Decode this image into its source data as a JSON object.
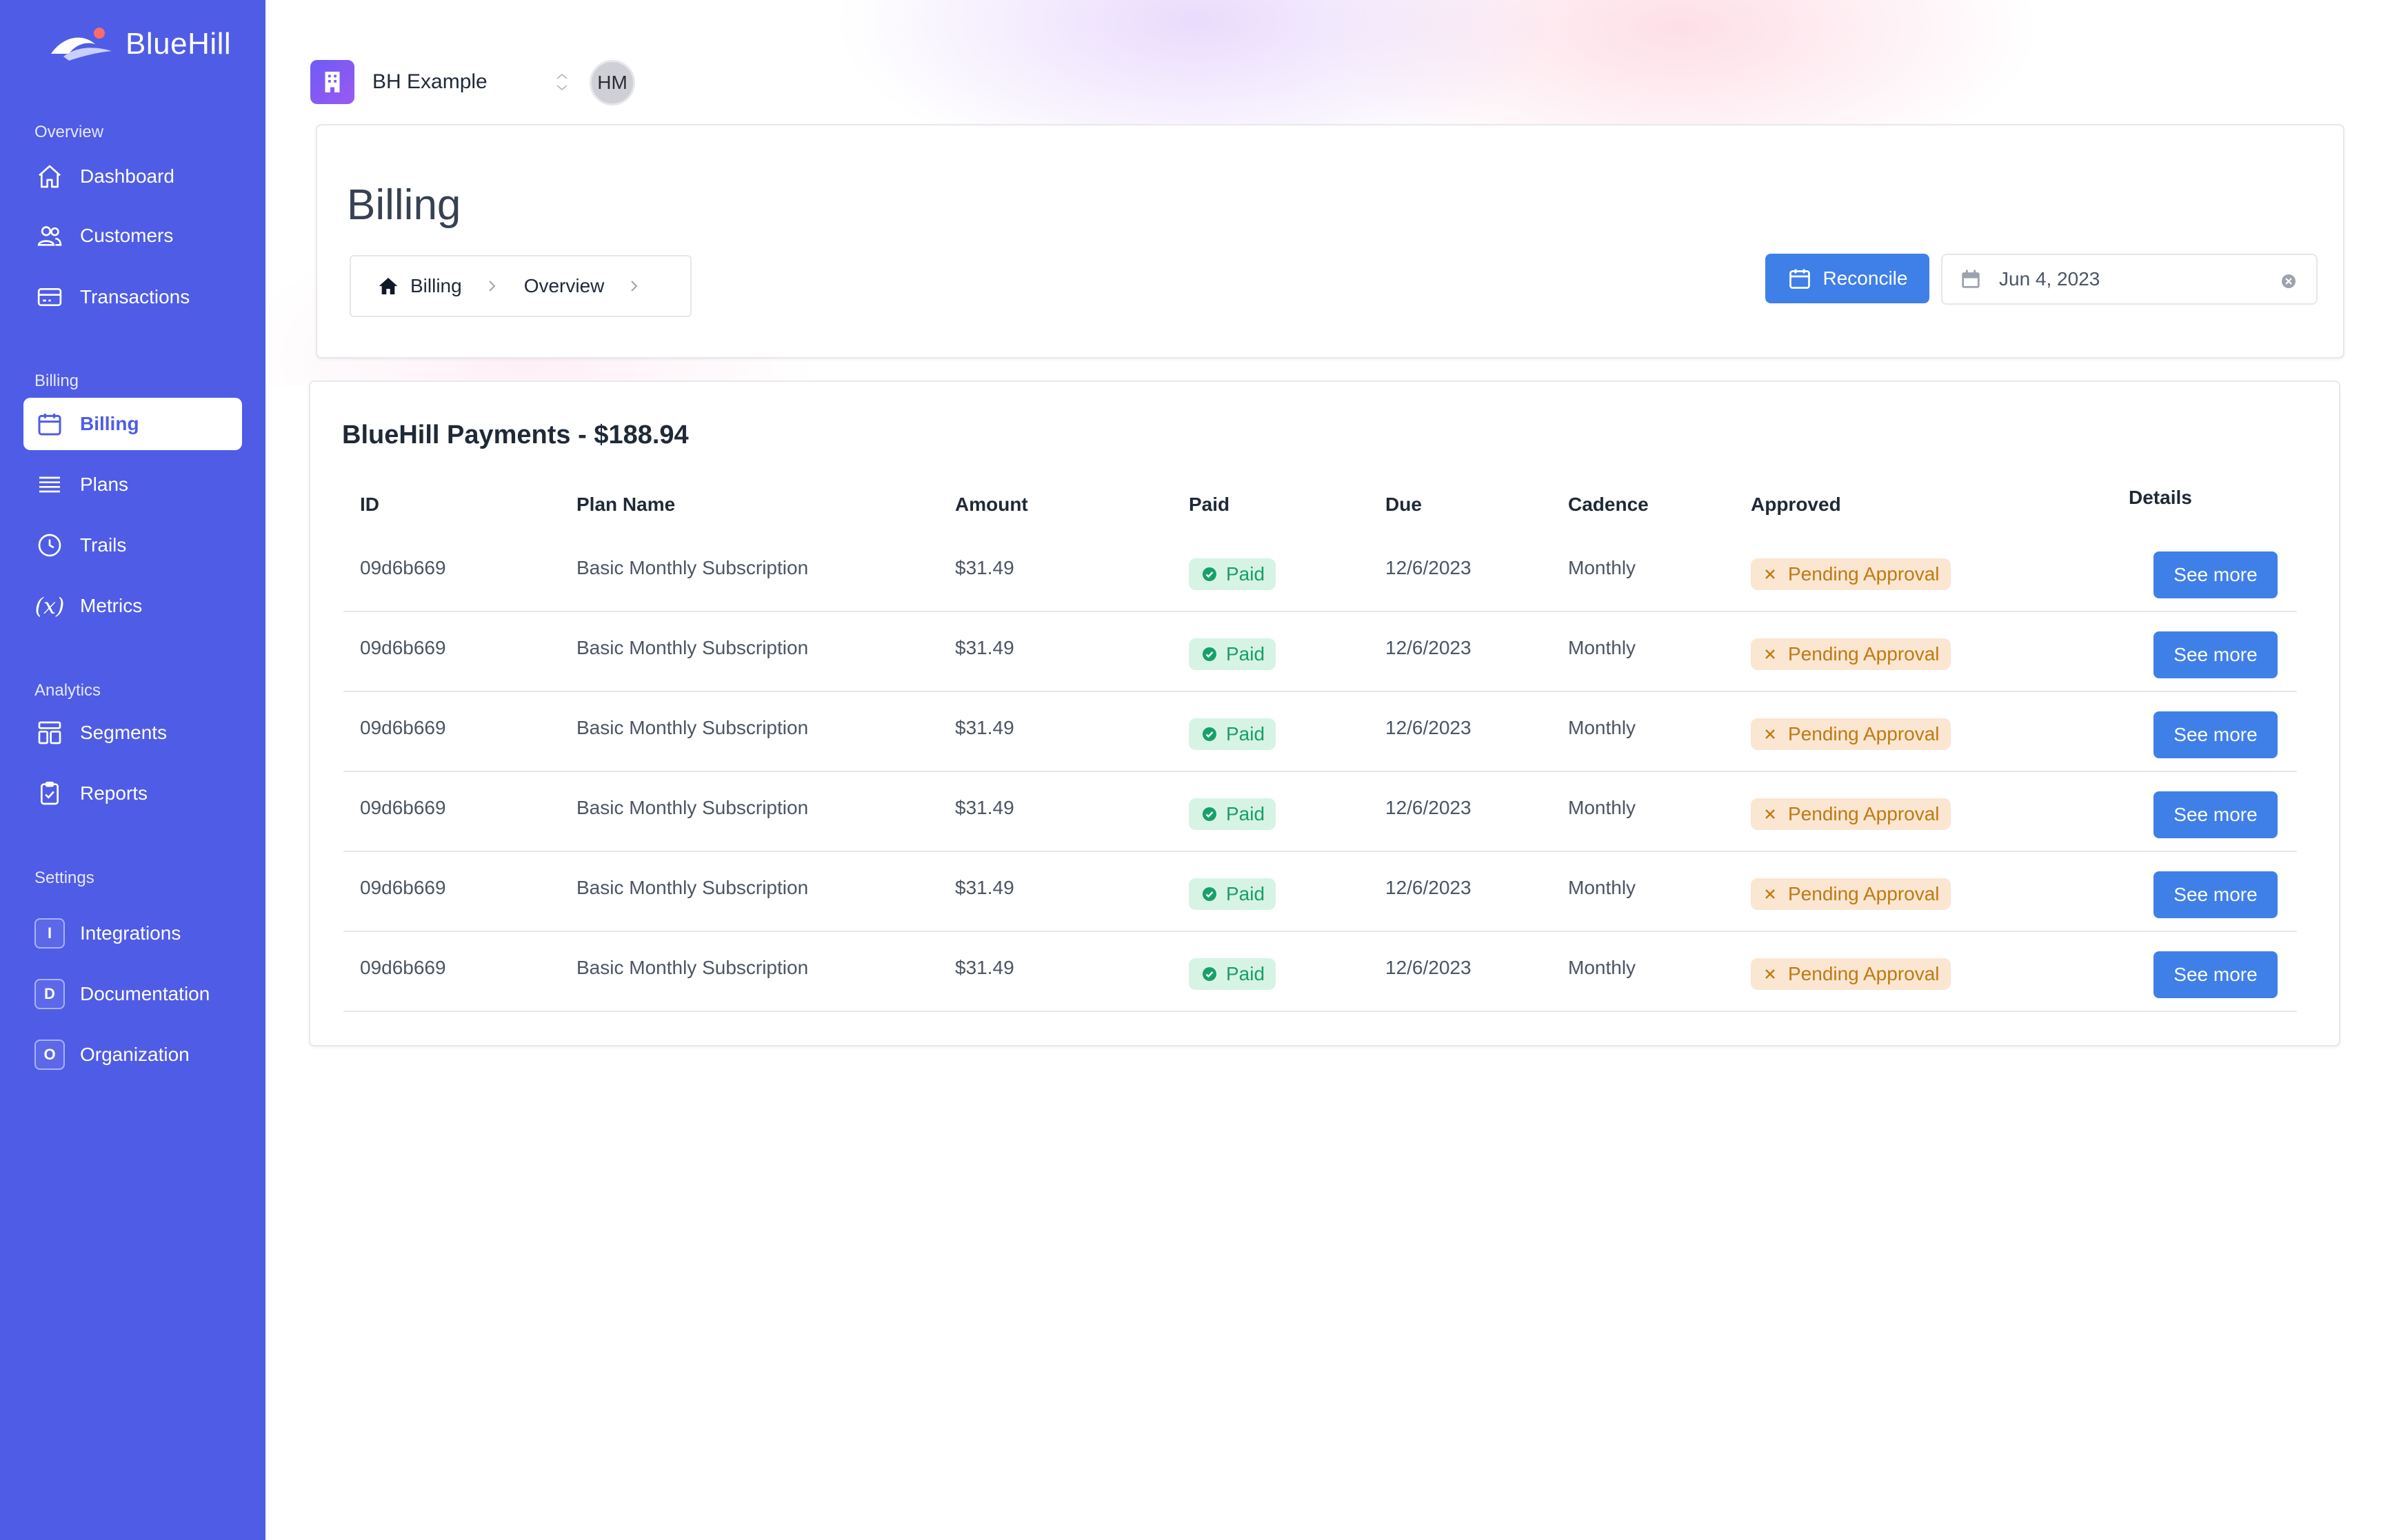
{
  "brand": {
    "name": "BlueHill"
  },
  "sidebar": {
    "sections": [
      {
        "label": "Overview"
      },
      {
        "label": "Billing"
      },
      {
        "label": "Analytics"
      },
      {
        "label": "Settings"
      }
    ],
    "items": [
      {
        "label": "Dashboard",
        "icon": "home-icon"
      },
      {
        "label": "Customers",
        "icon": "users-icon"
      },
      {
        "label": "Transactions",
        "icon": "credit-card-icon"
      },
      {
        "label": "Billing",
        "icon": "calendar-icon",
        "active": true
      },
      {
        "label": "Plans",
        "icon": "list-icon"
      },
      {
        "label": "Trails",
        "icon": "clock-icon"
      },
      {
        "label": "Metrics",
        "icon": "variable-icon",
        "glyph": "(x)"
      },
      {
        "label": "Segments",
        "icon": "segments-icon"
      },
      {
        "label": "Reports",
        "icon": "clipboard-check-icon"
      },
      {
        "label": "Integrations",
        "badge": "I"
      },
      {
        "label": "Documentation",
        "badge": "D"
      },
      {
        "label": "Organization",
        "badge": "O"
      }
    ]
  },
  "workspace": {
    "name": "BH Example",
    "avatar_initials": "HM"
  },
  "header": {
    "title": "Billing",
    "breadcrumb": [
      "Billing",
      "Overview"
    ],
    "reconcile_label": "Reconcile",
    "date_value": "Jun 4, 2023"
  },
  "payments": {
    "title": "BlueHill Payments - $188.94",
    "columns": [
      "ID",
      "Plan Name",
      "Amount",
      "Paid",
      "Due",
      "Cadence",
      "Approved",
      "Details"
    ],
    "rows": [
      {
        "id": "09d6b669",
        "plan": "Basic Monthly Subscription",
        "amount": "$31.49",
        "paid": "Paid",
        "due": "12/6/2023",
        "cadence": "Monthly",
        "approved": "Pending Approval",
        "action": "See more"
      },
      {
        "id": "09d6b669",
        "plan": "Basic Monthly Subscription",
        "amount": "$31.49",
        "paid": "Paid",
        "due": "12/6/2023",
        "cadence": "Monthly",
        "approved": "Pending Approval",
        "action": "See more"
      },
      {
        "id": "09d6b669",
        "plan": "Basic Monthly Subscription",
        "amount": "$31.49",
        "paid": "Paid",
        "due": "12/6/2023",
        "cadence": "Monthly",
        "approved": "Pending Approval",
        "action": "See more"
      },
      {
        "id": "09d6b669",
        "plan": "Basic Monthly Subscription",
        "amount": "$31.49",
        "paid": "Paid",
        "due": "12/6/2023",
        "cadence": "Monthly",
        "approved": "Pending Approval",
        "action": "See more"
      },
      {
        "id": "09d6b669",
        "plan": "Basic Monthly Subscription",
        "amount": "$31.49",
        "paid": "Paid",
        "due": "12/6/2023",
        "cadence": "Monthly",
        "approved": "Pending Approval",
        "action": "See more"
      },
      {
        "id": "09d6b669",
        "plan": "Basic Monthly Subscription",
        "amount": "$31.49",
        "paid": "Paid",
        "due": "12/6/2023",
        "cadence": "Monthly",
        "approved": "Pending Approval",
        "action": "See more"
      }
    ]
  },
  "colors": {
    "sidebar_bg": "#4f5ce6",
    "accent": "#3f7fe8",
    "paid_bg": "#d7f3e4",
    "paid_fg": "#16a06a",
    "pending_bg": "#fbe6d1",
    "pending_fg": "#c07a12"
  }
}
